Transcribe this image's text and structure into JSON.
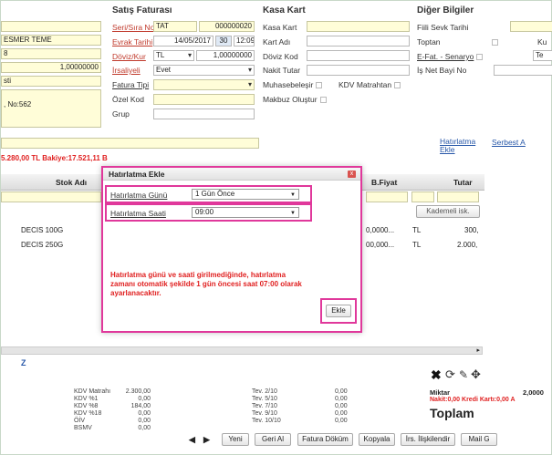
{
  "sections": {
    "sales": "Satış Faturası",
    "cash": "Kasa Kart",
    "other": "Diğer Bilgiler"
  },
  "left_fields": {
    "customer": "ESMER TEME",
    "code": "8",
    "rate": "1,00000000",
    "city": "sti",
    "address": ", No:562"
  },
  "sales_fields": {
    "series_label": "Seri/Sıra No",
    "series_val": "TAT",
    "seq_val": "000000020",
    "date_label": "Evrak Tarihi",
    "date_val": "14/05/2017",
    "cal_val": "30",
    "time_val": "12:09",
    "currency_label": "Döviz/Kur",
    "currency_val": "TL",
    "rate_val": "1,00000000",
    "waybill_label": "İrsaliyeli",
    "waybill_val": "Evet",
    "invoice_type_label": "Fatura Tipi",
    "special_code_label": "Özel Kod",
    "group_label": "Grup"
  },
  "cash_fields": {
    "cash_card": "Kasa Kart",
    "account_name": "Kart Adı",
    "currency_code": "Döviz Kod",
    "cash_amount": "Nakit Tutar",
    "accounting": "Muhasebeleşir",
    "vat_base": "KDV Matrahtan",
    "receipt": "Makbuz Oluştur"
  },
  "other_fields": {
    "shipment_date": "Fiili Sevk Tarihi",
    "wholesale": "Toptan",
    "ku": "Ku",
    "efat": "E-Fat. - Senaryo",
    "te": "Te",
    "dealer": "İş Net Bayi No",
    "reminder_link": "Hatırlatma Ekle",
    "free_link": "Serbest A"
  },
  "balance_text": "5.280,00 TL  Bakiye:17.521,11 B",
  "grid": {
    "col_name": "Stok Adı",
    "col_price": "B.Fiyat",
    "col_total": "Tutar",
    "step_label": "Kademeli isk.",
    "rows": [
      {
        "name": "DECIS 100G",
        "price": "0,0000...",
        "cur": "TL",
        "total": "300,"
      },
      {
        "name": "DECIS 250G",
        "price": "00,000...",
        "cur": "TL",
        "total": "2.000,"
      }
    ],
    "row_marker": "Z"
  },
  "dialog": {
    "title": "Hatırlatma Ekle",
    "close": "x",
    "day_label": "Hatırlatma Günü",
    "day_value": "1 Gün Önce",
    "time_label": "Hatırlatma Saati",
    "time_value": "09:00",
    "warning": "Hatırlatma günü ve saati girilmediğinde, hatırlatma zamanı otomatik şekilde 1 gün öncesi saat 07:00 olarak ayarlanacaktır.",
    "add_button": "Ekle"
  },
  "totals": {
    "labels1": [
      "KDV Matrahı",
      "KDV %1",
      "KDV %8",
      "KDV %18",
      "ÖİV",
      "BSMV"
    ],
    "values1": [
      "2.300,00",
      "0,00",
      "184,00",
      "0,00",
      "0,00",
      "0,00"
    ],
    "labels2": [
      "Tev. 2/10",
      "Tev. 5/10",
      "Tev. 7/10",
      "Tev. 9/10",
      "Tev. 10/10"
    ],
    "values2": [
      "0,00",
      "0,00",
      "0,00",
      "0,00",
      "0,00"
    ],
    "qty_label": "Miktar",
    "qty_value": "2,0000",
    "credit": "Nakit:0,00 Kredi Kartı:0,00 A",
    "total_label": "Toplam"
  },
  "buttons": {
    "new": "Yeni",
    "undo": "Geri Al",
    "print": "Fatura Döküm",
    "copy": "Kopyala",
    "link": "İrs. İlişkilendir",
    "mail": "Mail G"
  }
}
